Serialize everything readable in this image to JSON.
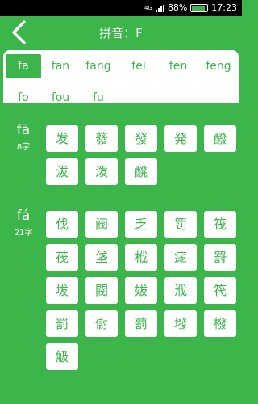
{
  "status": {
    "network": "4G",
    "battery": "88%",
    "time": "17:23"
  },
  "header": {
    "title": "拼音：F"
  },
  "tabs": {
    "row1": [
      "fa",
      "fan",
      "fang",
      "fei",
      "fen",
      "feng"
    ],
    "row2": [
      "fo",
      "fou",
      "fu"
    ],
    "active_index": 0
  },
  "sections": [
    {
      "pinyin": "fā",
      "count": "8字",
      "chars": [
        "发",
        "蕟",
        "發",
        "発",
        "醱",
        "沷",
        "泼",
        "醗"
      ]
    },
    {
      "pinyin": "fá",
      "count": "21字",
      "chars": [
        "伐",
        "阀",
        "乏",
        "罚",
        "筏",
        "茷",
        "垡",
        "栰",
        "疺",
        "罸",
        "坺",
        "閥",
        "妭",
        "浌",
        "笩",
        "罰",
        "傠",
        "藅",
        "墢",
        "橃",
        "觙"
      ]
    }
  ]
}
